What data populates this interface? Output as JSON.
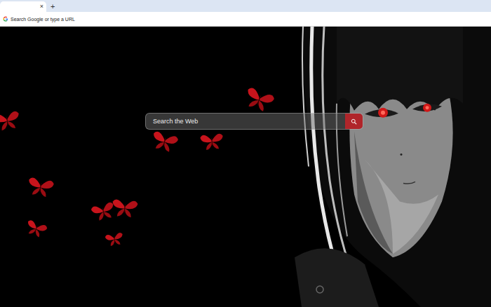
{
  "browser": {
    "tabs": [
      {
        "close": "×",
        "selected": true
      }
    ],
    "new_tab": "+",
    "address_bar": {
      "placeholder": "Search Google or type a URL"
    }
  },
  "search": {
    "placeholder": "Search the Web"
  }
}
